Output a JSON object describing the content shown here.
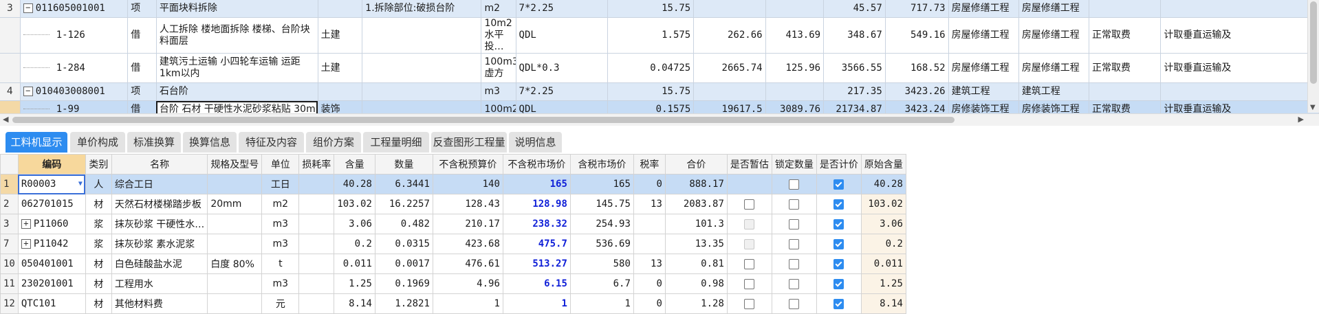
{
  "upper": {
    "rows": [
      {
        "row_num": "3",
        "type": "parent",
        "tree": "−",
        "code": "011605001001",
        "kind": "项",
        "name": "平面块料拆除",
        "major": "",
        "feature": "1.拆除部位:破损台阶",
        "unit": "m2",
        "expr": "7*2.25",
        "qty": "15.75",
        "price": "",
        "c1": "",
        "c2": "45.57",
        "total": "717.73",
        "cat1": "房屋修缮工程",
        "cat2": "房屋修缮工程",
        "fee": "",
        "note": ""
      },
      {
        "row_num": "",
        "type": "child",
        "tree": "",
        "code": "1-126",
        "kind": "借",
        "name": "人工拆除 楼地面拆除 楼梯、台阶块料面层",
        "major": "土建",
        "feature": "",
        "unit": "10m2水平投…",
        "expr": "QDL",
        "qty": "1.575",
        "price": "262.66",
        "c1": "413.69",
        "c2": "348.67",
        "total": "549.16",
        "cat1": "房屋修缮工程",
        "cat2": "房屋修缮工程",
        "fee": "正常取费",
        "note": "计取垂直运输及"
      },
      {
        "row_num": "",
        "type": "child",
        "tree": "",
        "code": "1-284",
        "kind": "借",
        "name": "建筑污土运输 小四轮车运输 运距1km以内",
        "major": "土建",
        "feature": "",
        "unit": "100m3虚方",
        "expr": "QDL*0.3",
        "qty": "0.04725",
        "price": "2665.74",
        "c1": "125.96",
        "c2": "3566.55",
        "total": "168.52",
        "cat1": "房屋修缮工程",
        "cat2": "房屋修缮工程",
        "fee": "正常取费",
        "note": "计取垂直运输及"
      },
      {
        "row_num": "4",
        "type": "parent",
        "tree": "−",
        "code": "010403008001",
        "kind": "项",
        "name": "石台阶",
        "major": "",
        "feature": "",
        "unit": "m3",
        "expr": "7*2.25",
        "qty": "15.75",
        "price": "",
        "c1": "",
        "c2": "217.35",
        "total": "3423.26",
        "cat1": "建筑工程",
        "cat2": "建筑工程",
        "fee": "",
        "note": ""
      },
      {
        "row_num": "",
        "type": "selected",
        "tree": "",
        "code": "1-99",
        "kind": "借",
        "name": "台阶 石材 干硬性水泥砂浆粘贴 30mm",
        "major": "装饰",
        "feature": "",
        "unit": "100m2",
        "expr": "QDL",
        "qty": "0.1575",
        "price": "19617.5",
        "c1": "3089.76",
        "c2": "21734.87",
        "total": "3423.24",
        "cat1": "房修装饰工程",
        "cat2": "房修装饰工程",
        "fee": "正常取费",
        "note": "计取垂直运输及"
      }
    ]
  },
  "tabs": [
    {
      "label": "工料机显示",
      "active": true
    },
    {
      "label": "单价构成",
      "active": false
    },
    {
      "label": "标准换算",
      "active": false
    },
    {
      "label": "换算信息",
      "active": false
    },
    {
      "label": "特征及内容",
      "active": false
    },
    {
      "label": "组价方案",
      "active": false
    },
    {
      "label": "工程量明细",
      "active": false
    },
    {
      "label": "反查图形工程量",
      "active": false
    },
    {
      "label": "说明信息",
      "active": false
    }
  ],
  "lower": {
    "headers": [
      "编码",
      "类别",
      "名称",
      "规格及型号",
      "单位",
      "损耗率",
      "含量",
      "数量",
      "不含税预算价",
      "不含税市场价",
      "含税市场价",
      "税率",
      "合价",
      "是否暂估",
      "锁定数量",
      "是否计价",
      "原始含量"
    ],
    "rows": [
      {
        "idx": "1",
        "code": "R00003",
        "expand": "",
        "cat": "人",
        "name": "综合工日",
        "spec": "",
        "unit": "工日",
        "loss": "",
        "content": "40.28",
        "qty": "6.3441",
        "budget": "140",
        "market": "165",
        "market_tax": "165",
        "tax": "0",
        "total": "888.17",
        "temp": "none",
        "lock": "unchecked",
        "price_flag": "checked",
        "orig": "40.28",
        "selected": true
      },
      {
        "idx": "2",
        "code": "062701015",
        "expand": "",
        "cat": "材",
        "name": "天然石材楼梯踏步板",
        "spec": "20mm",
        "unit": "m2",
        "loss": "",
        "content": "103.02",
        "qty": "16.2257",
        "budget": "128.43",
        "market": "128.98",
        "market_tax": "145.75",
        "tax": "13",
        "total": "2083.87",
        "temp": "unchecked",
        "lock": "unchecked",
        "price_flag": "checked",
        "orig": "103.02",
        "selected": false
      },
      {
        "idx": "3",
        "code": "P11060",
        "expand": "+",
        "cat": "浆",
        "name": "抹灰砂浆 干硬性水…",
        "spec": "",
        "unit": "m3",
        "loss": "",
        "content": "3.06",
        "qty": "0.482",
        "budget": "210.17",
        "market": "238.32",
        "market_tax": "254.93",
        "tax": "",
        "total": "101.3",
        "temp": "disabled",
        "lock": "unchecked",
        "price_flag": "checked",
        "orig": "3.06",
        "selected": false
      },
      {
        "idx": "7",
        "code": "P11042",
        "expand": "+",
        "cat": "浆",
        "name": "抹灰砂浆 素水泥浆",
        "spec": "",
        "unit": "m3",
        "loss": "",
        "content": "0.2",
        "qty": "0.0315",
        "budget": "423.68",
        "market": "475.7",
        "market_tax": "536.69",
        "tax": "",
        "total": "13.35",
        "temp": "disabled",
        "lock": "unchecked",
        "price_flag": "checked",
        "orig": "0.2",
        "selected": false
      },
      {
        "idx": "10",
        "code": "050401001",
        "expand": "",
        "cat": "材",
        "name": "白色硅酸盐水泥",
        "spec": "白度 80%",
        "unit": "t",
        "loss": "",
        "content": "0.011",
        "qty": "0.0017",
        "budget": "476.61",
        "market": "513.27",
        "market_tax": "580",
        "tax": "13",
        "total": "0.81",
        "temp": "unchecked",
        "lock": "unchecked",
        "price_flag": "checked",
        "orig": "0.011",
        "selected": false
      },
      {
        "idx": "11",
        "code": "230201001",
        "expand": "",
        "cat": "材",
        "name": "工程用水",
        "spec": "",
        "unit": "m3",
        "loss": "",
        "content": "1.25",
        "qty": "0.1969",
        "budget": "4.96",
        "market": "6.15",
        "market_tax": "6.7",
        "tax": "0",
        "total": "0.98",
        "temp": "unchecked",
        "lock": "unchecked",
        "price_flag": "checked",
        "orig": "1.25",
        "selected": false
      },
      {
        "idx": "12",
        "code": "QTC101",
        "expand": "",
        "cat": "材",
        "name": "其他材料费",
        "spec": "",
        "unit": "元",
        "loss": "",
        "content": "8.14",
        "qty": "1.2821",
        "budget": "1",
        "market": "1",
        "market_tax": "1",
        "tax": "0",
        "total": "1.28",
        "temp": "unchecked",
        "lock": "unchecked",
        "price_flag": "checked",
        "orig": "8.14",
        "selected": false
      }
    ]
  },
  "colors": {
    "accent": "#2d8cf0",
    "selected_row": "#c6dcf5",
    "parent_row": "#dde9f7",
    "market_price": "#1020d8",
    "header_key": "#f7d89c"
  }
}
